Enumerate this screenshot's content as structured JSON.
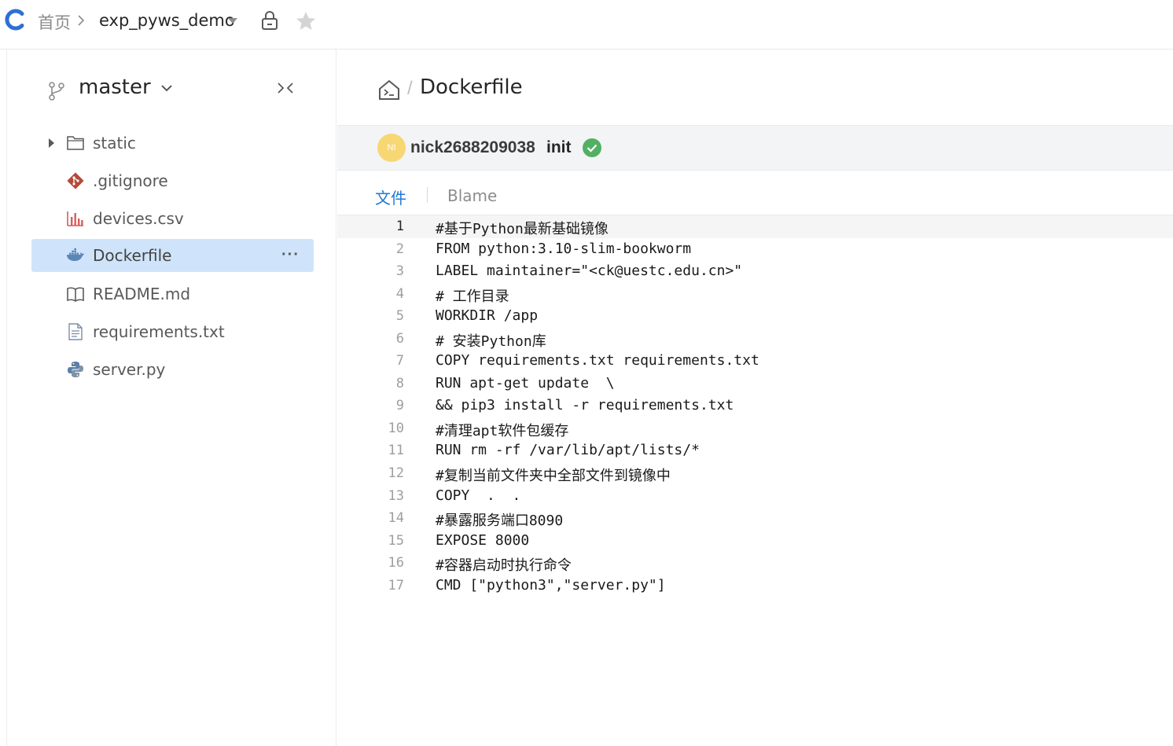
{
  "topbar": {
    "logo_icon": "logo-c-icon",
    "breadcrumb_home": "首页",
    "repo_name": "exp_pyws_demo"
  },
  "sidebar": {
    "branch": "master",
    "items": [
      {
        "label": "static",
        "icon": "folder-icon",
        "expandable": true,
        "active": false
      },
      {
        "label": ".gitignore",
        "icon": "git-icon",
        "active": false
      },
      {
        "label": "devices.csv",
        "icon": "bar-chart-icon",
        "active": false
      },
      {
        "label": "Dockerfile",
        "icon": "docker-icon",
        "active": true
      },
      {
        "label": "README.md",
        "icon": "book-icon",
        "active": false
      },
      {
        "label": "requirements.txt",
        "icon": "text-file-icon",
        "active": false
      },
      {
        "label": "server.py",
        "icon": "python-icon",
        "active": false
      }
    ],
    "more_label": "···"
  },
  "main": {
    "path_sep": "/",
    "file_name": "Dockerfile",
    "commit": {
      "avatar_initials": "NI",
      "author": "nick2688209038",
      "message": "init",
      "status": "success"
    },
    "tabs": {
      "file": "文件",
      "blame": "Blame"
    },
    "current_line": 1,
    "lines": [
      "#基于Python最新基础镜像",
      "FROM python:3.10-slim-bookworm",
      "LABEL maintainer=\"<ck@uestc.edu.cn>\"",
      "# 工作目录",
      "WORKDIR /app",
      "# 安装Python库",
      "COPY requirements.txt requirements.txt",
      "RUN apt-get update  \\",
      "&& pip3 install -r requirements.txt",
      "#清理apt软件包缓存",
      "RUN rm -rf /var/lib/apt/lists/*",
      "#复制当前文件夹中全部文件到镜像中",
      "COPY  .  .",
      "#暴露服务端口8090",
      "EXPOSE 8000",
      "#容器启动时执行命令",
      "CMD [\"python3\",\"server.py\"]"
    ]
  },
  "colors": {
    "accent": "#1f78d1",
    "logo": "#2f6fd3",
    "active_item_bg": "#cfe4fb",
    "success": "#52b063",
    "avatar_bg": "#f7d774",
    "commit_bar_bg": "#f3f4f5"
  }
}
